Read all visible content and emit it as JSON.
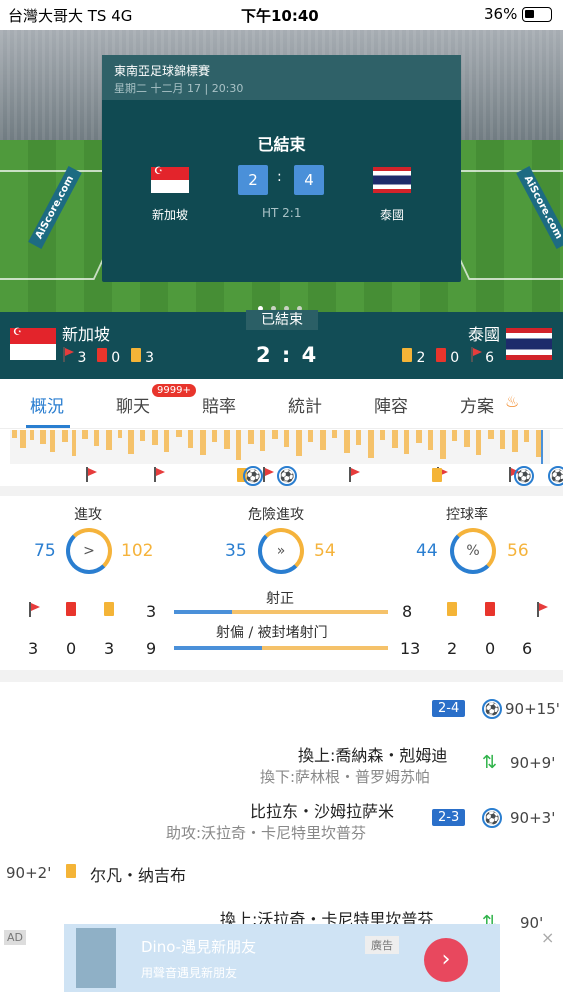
{
  "status_bar": {
    "carrier": "台灣大哥大 TS  4G",
    "time": "下午10:40",
    "battery": "36%"
  },
  "match": {
    "competition": "東南亞足球錦標賽",
    "kickoff": "星期二 十二月 17 | 20:30",
    "state": "已結束",
    "home": {
      "name": "新加坡",
      "score": "2"
    },
    "away": {
      "name": "泰國",
      "score": "4"
    },
    "score_sep": ":",
    "halftime": "HT 2:1",
    "score_display": "2 : 4",
    "home_corners": "3",
    "home_red": "0",
    "home_yellow": "3",
    "away_yellow": "2",
    "away_red": "0",
    "away_corners": "6"
  },
  "tabs": [
    {
      "label": "概況",
      "active": true
    },
    {
      "label": "聊天",
      "badge": "9999+"
    },
    {
      "label": "賠率"
    },
    {
      "label": "統計"
    },
    {
      "label": "陣容"
    },
    {
      "label": "方案",
      "icon": "fire-icon"
    }
  ],
  "stats": {
    "attack": {
      "label": "進攻",
      "home": "75",
      "away": "102",
      "icon": ">"
    },
    "dangerous": {
      "label": "危險進攻",
      "home": "35",
      "away": "54",
      "icon": "»"
    },
    "possession": {
      "label": "控球率",
      "home": "44",
      "away": "56",
      "icon": "%"
    },
    "on_target": {
      "label": "射正",
      "home": "3",
      "away": "8",
      "home_share": 0.27
    },
    "off_target": {
      "label": "射偏 / 被封堵射门",
      "home": "9",
      "away": "13",
      "home_share": 0.41
    },
    "home_cards": {
      "corners": "3",
      "red": "0",
      "yellow": "3"
    },
    "away_cards": {
      "yellow": "2",
      "red": "0",
      "corners": "6"
    }
  },
  "events": [
    {
      "type": "goal",
      "score": "2-4",
      "minute": "90+15'"
    },
    {
      "type": "sub",
      "on": "換上:喬納森・剋姆迪",
      "off": "換下:萨林根・普罗姆苏帕",
      "minute": "90+9'"
    },
    {
      "type": "goal",
      "player": "比拉东・沙姆拉萨米",
      "assist": "助攻:沃拉奇・卡尼特里坎普芬",
      "score": "2-3",
      "minute": "90+3'"
    },
    {
      "type": "yellow",
      "player": "尔凡・纳吉布",
      "minute": "90+2'"
    },
    {
      "type": "sub",
      "on": "換上:沃拉奇・卡尼特里坎普芬",
      "minute": "90'"
    }
  ],
  "ad": {
    "tag": "AD",
    "title": "Dino-遇見新朋友",
    "subtitle": "用聲音遇見新朋友",
    "label": "廣告",
    "close": "×"
  },
  "board_text": "AiScore.com",
  "colors": {
    "accent": "#2a7ed0",
    "home": "#2a7ed0",
    "away": "#f5b33b",
    "dark": "#124d56"
  }
}
